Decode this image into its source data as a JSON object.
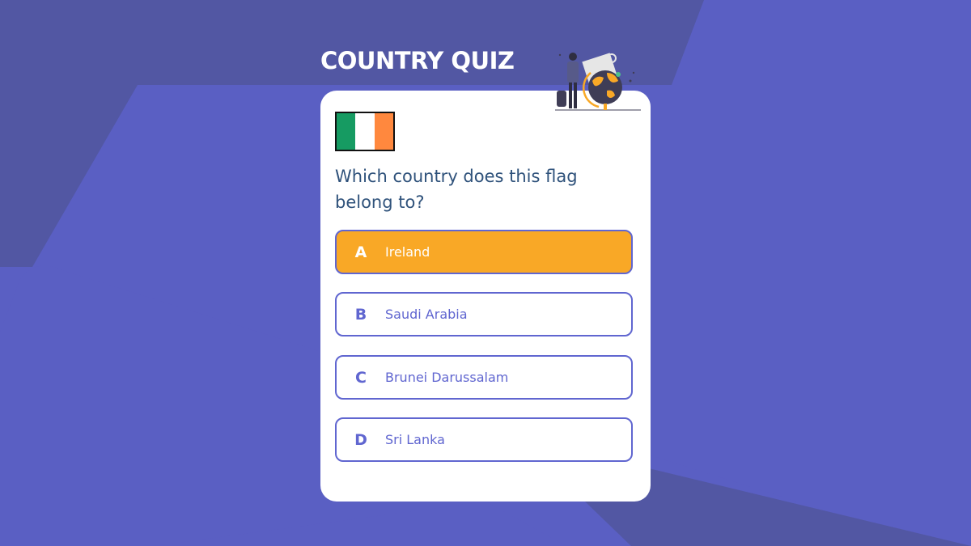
{
  "app": {
    "title": "COUNTRY QUIZ"
  },
  "colors": {
    "background": "#5a5fc3",
    "background_shape_dark": "#5257a3",
    "accent": "#6066d0",
    "selected": "#f9a826",
    "question_text": "#2f527b"
  },
  "icons": {
    "header": "traveler-globe-illustration",
    "flag": "ireland-flag"
  },
  "quiz": {
    "question": "Which country does this flag belong to?",
    "selected_option": "A",
    "options": [
      {
        "letter": "A",
        "label": "Ireland"
      },
      {
        "letter": "B",
        "label": "Saudi Arabia"
      },
      {
        "letter": "C",
        "label": "Brunei Darussalam"
      },
      {
        "letter": "D",
        "label": "Sri Lanka"
      }
    ]
  }
}
